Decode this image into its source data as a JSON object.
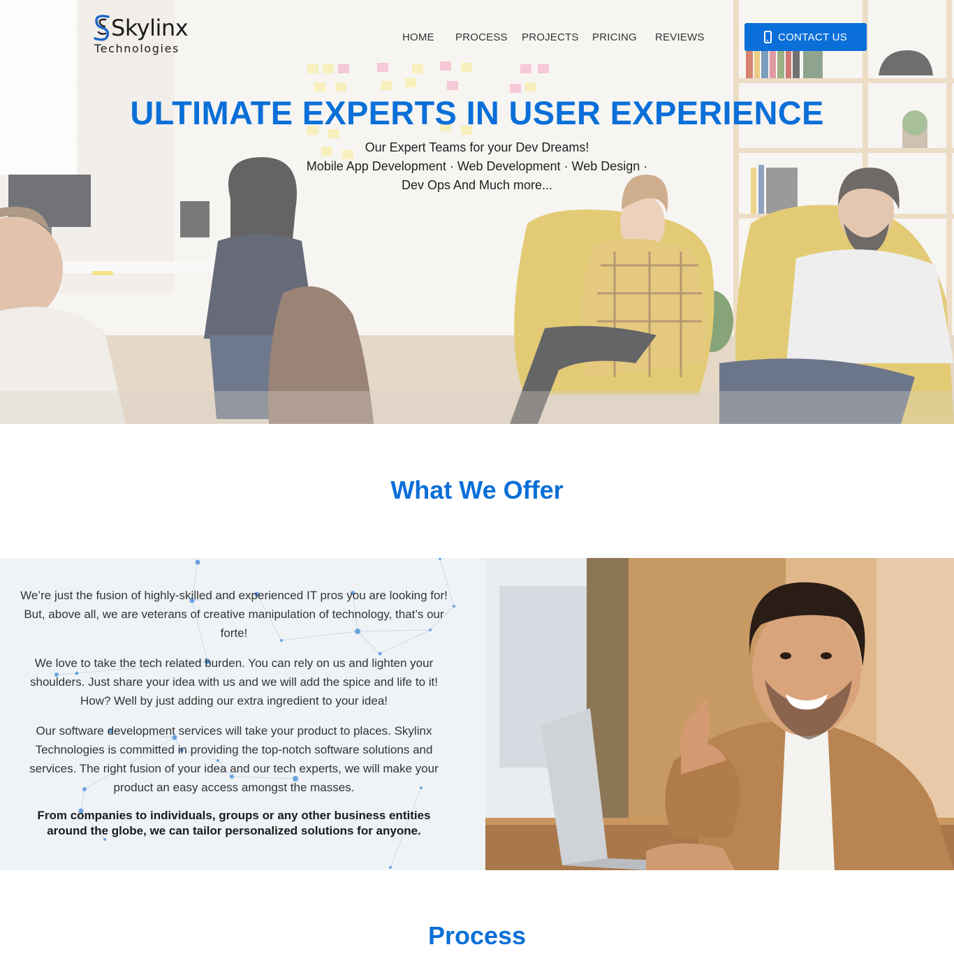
{
  "brand": {
    "name": "Skylinx",
    "tagline": "Technologies",
    "accent_color": "#0a6fd8"
  },
  "nav": {
    "items": [
      {
        "label": "HOME"
      },
      {
        "label": "PROCESS"
      },
      {
        "label": "PROJECTS"
      },
      {
        "label": "PRICING"
      },
      {
        "label": "REVIEWS"
      }
    ],
    "contact": {
      "label": "CONTACT US",
      "icon": "phone-icon"
    }
  },
  "hero": {
    "title": "ULTIMATE EXPERTS IN USER EXPERIENCE",
    "lines": [
      "Our Expert Teams for your Dev Dreams!",
      "Mobile App Development · Web Development · Web Design ·",
      "Dev Ops And Much more..."
    ]
  },
  "offer": {
    "title": "What We Offer",
    "paragraphs": [
      "We’re just the fusion of highly-skilled and experienced IT pros you are looking for! But, above all, we are veterans of creative manipulation of technology, that’s our forte!",
      "We love to take the tech related burden. You can rely on us and lighten your shoulders. Just share your idea with us and we will add the spice and life to it! How? Well by just adding our extra ingredient to your idea!",
      "Our software development services will take your product to places. Skylinx Technologies is committed in providing the top-notch software solutions and services. The right fusion of your idea and our tech experts, we will make your product an easy access amongst the masses."
    ],
    "highlight": "From companies to individuals, groups or any other business entities around the globe, we can tailor personalized solutions for anyone."
  },
  "process": {
    "title": "Process"
  }
}
